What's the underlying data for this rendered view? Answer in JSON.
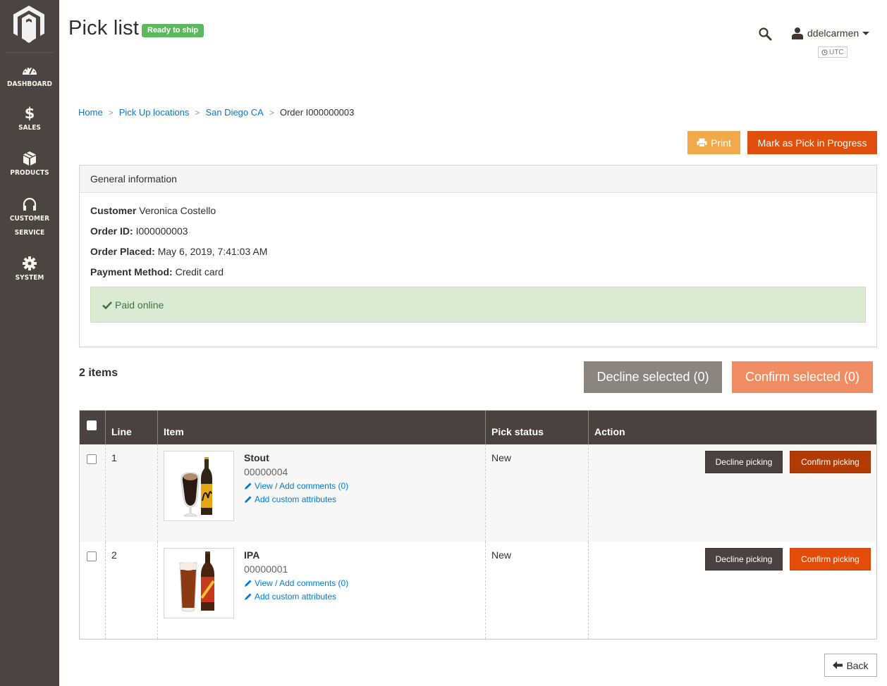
{
  "sidebar": {
    "logo": "magento-logo",
    "items": [
      {
        "label": "DASHBOARD",
        "icon": "dashboard-gauge-icon"
      },
      {
        "label": "SALES",
        "icon": "dollar-icon"
      },
      {
        "label": "PRODUCTS",
        "icon": "box-icon"
      },
      {
        "label": "CUSTOMER",
        "label2": "SERVICE",
        "icon": "headset-icon"
      },
      {
        "label": "SYSTEM",
        "icon": "gear-icon"
      }
    ]
  },
  "header": {
    "title": "Pick list",
    "status_badge": "Ready to ship",
    "status_badge_color": "#5cb85c",
    "user_name": "ddelcarmen",
    "timezone": "UTC"
  },
  "breadcrumb": {
    "items": [
      "Home",
      "Pick Up locations",
      "San Diego CA"
    ],
    "current": "Order I000000003",
    "separator": ">"
  },
  "actions": {
    "print_label": "Print",
    "mark_label": "Mark as Pick in Progress",
    "print_color": "#f0a94b",
    "mark_color": "#e04f0b"
  },
  "general_info": {
    "title": "General information",
    "customer_label": "Customer",
    "customer_value": "Veronica Costello",
    "order_id_label": "Order ID:",
    "order_id_value": "I000000003",
    "order_placed_label": "Order Placed:",
    "order_placed_value": "May 6, 2019, 7:41:03 AM",
    "payment_label": "Payment Method:",
    "payment_value": "Credit card",
    "paid_status": "Paid online"
  },
  "items_bar": {
    "count_label": "2 items",
    "decline_selected": "Decline selected (0)",
    "confirm_selected": "Confirm selected (0)"
  },
  "table": {
    "columns": [
      "",
      "Line",
      "Item",
      "Pick status",
      "Action"
    ],
    "rows": [
      {
        "line": "1",
        "name": "Stout",
        "sku": "00000004",
        "comments_link": "View / Add comments (0)",
        "attributes_link": "Add custom attributes",
        "pick_status": "New",
        "decline_label": "Decline picking",
        "confirm_label": "Confirm picking"
      },
      {
        "line": "2",
        "name": "IPA",
        "sku": "00000001",
        "comments_link": "View / Add comments (0)",
        "attributes_link": "Add custom attributes",
        "pick_status": "New",
        "decline_label": "Decline picking",
        "confirm_label": "Confirm picking"
      }
    ]
  },
  "footer": {
    "back_label": "Back"
  }
}
